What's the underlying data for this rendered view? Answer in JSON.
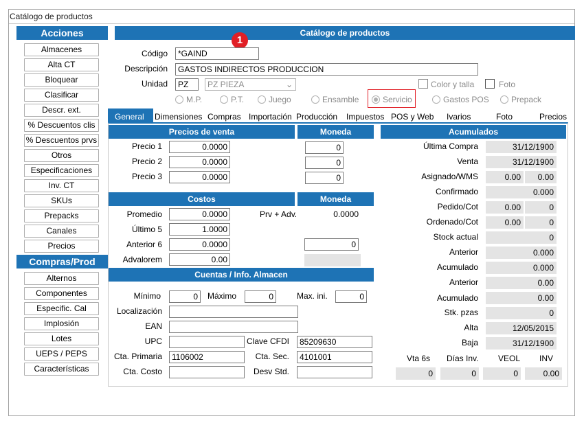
{
  "window_title": "Catálogo de productos",
  "sidebar": {
    "acciones_title": "Acciones",
    "acciones": [
      "Almacenes",
      "Alta CT",
      "Bloquear",
      "Clasificar",
      "Descr. ext.",
      "% Descuentos clis",
      "% Descuentos prvs",
      "Otros",
      "Especificaciones",
      "Inv. CT",
      "SKUs",
      "Prepacks",
      "Canales",
      "Precios"
    ],
    "compras_title": "Compras/Prod",
    "compras": [
      "Alternos",
      "Componentes",
      "Especific. Cal",
      "Implosión",
      "Lotes",
      "UEPS / PEPS",
      "Características"
    ]
  },
  "main": {
    "header": "Catálogo de productos",
    "badge": "1",
    "codigo_label": "Código",
    "codigo_value": "*GAIND",
    "descripcion_label": "Descripción",
    "descripcion_value": "GASTOS INDIRECTOS PRODUCCION",
    "unidad_label": "Unidad",
    "unidad_value": "PZ",
    "unidad_select": "PZ  PIEZA",
    "color_talla": "Color y talla",
    "foto_chk": "Foto",
    "radios": [
      "M.P.",
      "P.T.",
      "Juego",
      "Ensamble",
      "Servicio",
      "Gastos POS",
      "Prepack"
    ],
    "selected_radio": "Servicio"
  },
  "tabs": [
    "General",
    "Dimensiones",
    "Compras",
    "Importación",
    "Producción",
    "Impuestos",
    "POS y Web",
    "Ivarios",
    "Foto",
    "Precios"
  ],
  "precios_venta": {
    "title": "Precios de venta",
    "moneda_title": "Moneda",
    "rows": [
      {
        "label": "Precio 1",
        "value": "0.0000",
        "moneda": "0"
      },
      {
        "label": "Precio 2",
        "value": "0.0000",
        "moneda": "0"
      },
      {
        "label": "Precio 3",
        "value": "0.0000",
        "moneda": "0"
      }
    ]
  },
  "costos": {
    "title": "Costos",
    "moneda_title": "Moneda",
    "promedio_label": "Promedio",
    "promedio": "0.0000",
    "prv_adv_label": "Prv + Adv.",
    "prv_adv": "0.0000",
    "ultimo_label": "Último 5",
    "ultimo": "1.0000",
    "anterior_label": "Anterior 6",
    "anterior": "0.0000",
    "anterior_moneda": "0",
    "advalorem_label": "Advalorem",
    "advalorem": "0.00"
  },
  "cuentas": {
    "title": "Cuentas / Info. Almacen",
    "minimo_label": "Mínimo",
    "minimo": "0",
    "maximo_label": "Máximo",
    "maximo": "0",
    "maxini_label": "Max. ini.",
    "maxini": "0",
    "localizacion_label": "Localización",
    "ean_label": "EAN",
    "upc_label": "UPC",
    "clave_cfdi_label": "Clave CFDI",
    "clave_cfdi": "85209630",
    "cta_primaria_label": "Cta. Primaria",
    "cta_primaria": "1106002",
    "cta_sec_label": "Cta. Sec.",
    "cta_sec": "4101001",
    "cta_costo_label": "Cta. Costo",
    "desv_std_label": "Desv Std."
  },
  "acumulados": {
    "title": "Acumulados",
    "ultima_compra_label": "Última  Compra",
    "ultima_compra": "31/12/1900",
    "venta_label": "Venta",
    "venta": "31/12/1900",
    "asignado_label": "Asignado/WMS",
    "asignado_a": "0.00",
    "asignado_b": "0.00",
    "confirmado_label": "Confirmado",
    "confirmado": "0.000",
    "pedido_label": "Pedido/Cot",
    "pedido_a": "0.00",
    "pedido_b": "0",
    "ordenado_label": "Ordenado/Cot",
    "ordenado_a": "0.00",
    "ordenado_b": "0",
    "stock_label": "Stock actual",
    "stock": "0",
    "anterior1_label": "Anterior",
    "anterior1": "0.000",
    "acumulado1_label": "Acumulado",
    "acumulado1": "0.000",
    "anterior2_label": "Anterior",
    "anterior2": "0.00",
    "acumulado2_label": "Acumulado",
    "acumulado2": "0.00",
    "stk_label": "Stk. pzas",
    "stk": "0",
    "alta_label": "Alta",
    "alta": "12/05/2015",
    "baja_label": "Baja",
    "baja": "31/12/1900",
    "foot_labels": [
      "Vta 6s",
      "Días Inv.",
      "VEOL",
      "INV"
    ],
    "foot_values": [
      "0",
      "0",
      "0",
      "0.00"
    ]
  }
}
